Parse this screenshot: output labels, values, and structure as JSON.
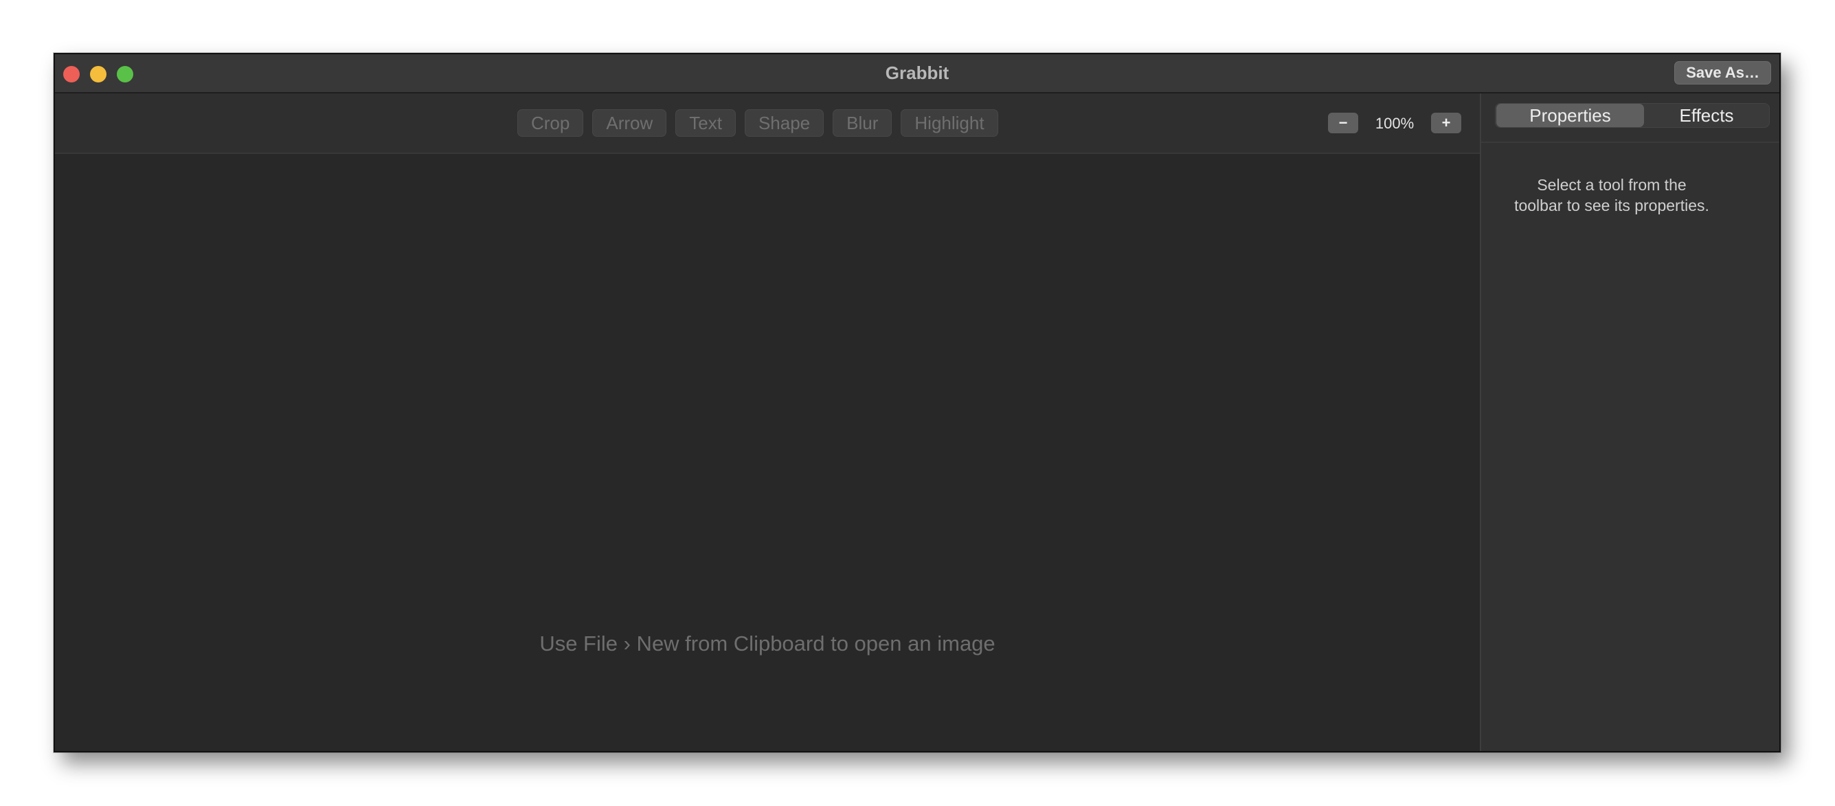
{
  "window": {
    "title": "Grabbit",
    "save_label": "Save As…"
  },
  "toolbar": {
    "tools": [
      "Crop",
      "Arrow",
      "Text",
      "Shape",
      "Blur",
      "Highlight"
    ],
    "zoom_minus": "−",
    "zoom_level": "100%",
    "zoom_plus": "+"
  },
  "canvas": {
    "empty_message": "Use File › New from Clipboard to open an image"
  },
  "sidebar": {
    "tabs": [
      "Properties",
      "Effects"
    ],
    "active_tab": "Properties",
    "hint_line1": "Select a tool from the",
    "hint_line2": "toolbar to see its properties."
  },
  "colors": {
    "close": "#ee5f57",
    "minimize": "#f4bd3c",
    "maximize": "#5ac148",
    "window_bg": "#282828"
  }
}
